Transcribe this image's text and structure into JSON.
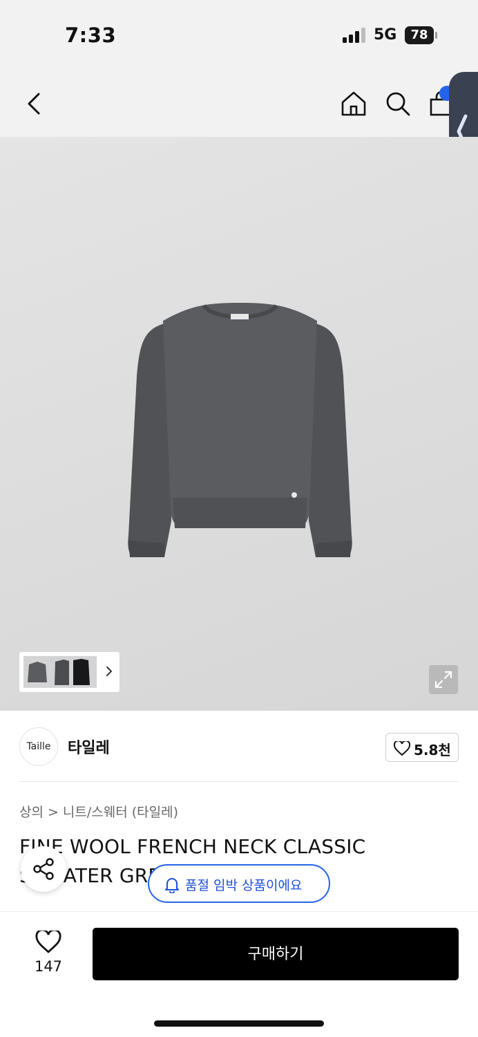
{
  "status_bar": {
    "time": "7:33",
    "network": "5G",
    "battery": "78"
  },
  "nav": {
    "icons": [
      "back-icon",
      "home-icon",
      "search-icon",
      "cart-icon"
    ]
  },
  "brand": {
    "logo_text": "Taille",
    "name": "타일레",
    "like_count": "5.8천"
  },
  "breadcrumb": {
    "category": "상의",
    "separator": ">",
    "subcategory": "니트/스웨터 (타일레)"
  },
  "product": {
    "title": "FINE WOOL FRENCH NECK CLASSIC SWEATER GREY",
    "soldout_notice": "품절 임박 상품이에요"
  },
  "bottom_bar": {
    "wish_count": "147",
    "buy_label": "구매하기"
  },
  "colors": {
    "accent": "#2563eb",
    "sweater": "#5a5c60",
    "buy_button": "#000000"
  }
}
